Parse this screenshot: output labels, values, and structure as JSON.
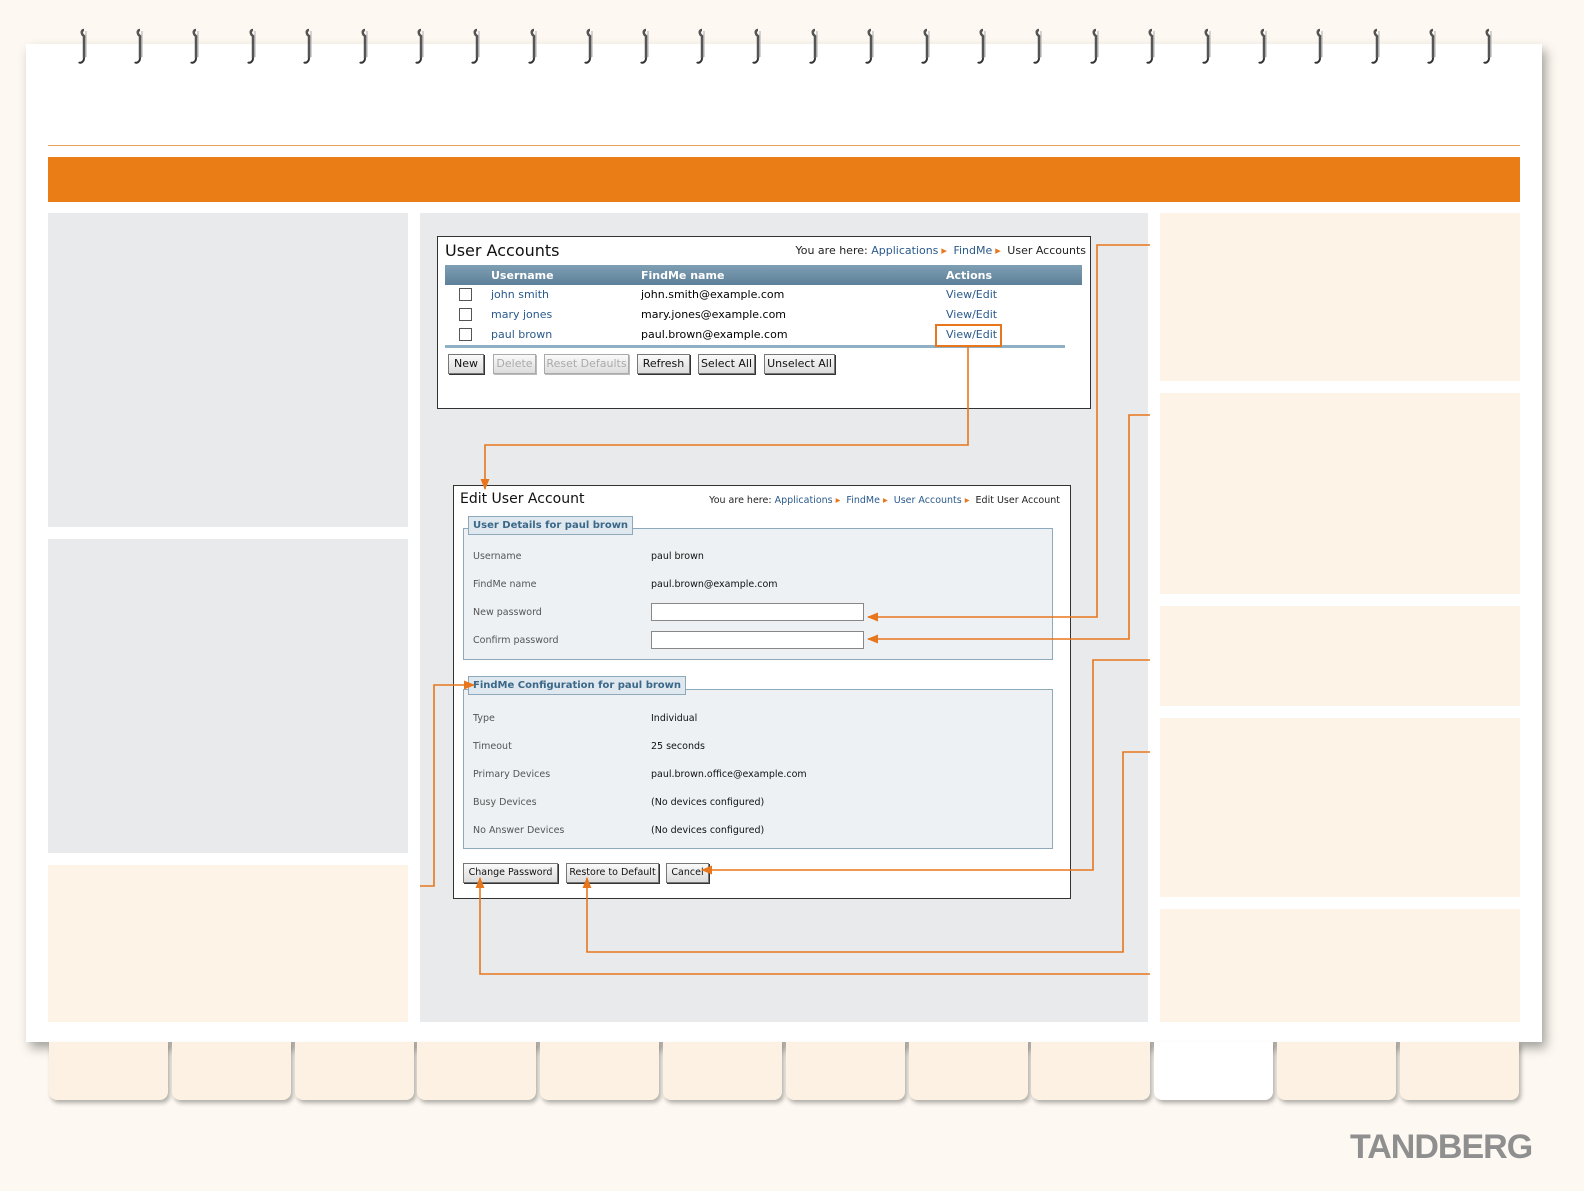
{
  "user_accounts": {
    "title": "User Accounts",
    "breadcrumb": {
      "prefix": "You are here:",
      "items": [
        "Applications",
        "FindMe",
        "User Accounts"
      ]
    },
    "columns": [
      "Username",
      "FindMe name",
      "Actions"
    ],
    "rows": [
      {
        "username": "john smith",
        "findme": "john.smith@example.com",
        "action": "View/Edit"
      },
      {
        "username": "mary jones",
        "findme": "mary.jones@example.com",
        "action": "View/Edit"
      },
      {
        "username": "paul brown",
        "findme": "paul.brown@example.com",
        "action": "View/Edit"
      }
    ],
    "buttons": {
      "new": "New",
      "delete": "Delete",
      "reset_defaults": "Reset Defaults",
      "refresh": "Refresh",
      "select_all": "Select All",
      "unselect_all": "Unselect All"
    }
  },
  "edit_user": {
    "title": "Edit User Account",
    "breadcrumb": {
      "prefix": "You are here:",
      "items": [
        "Applications",
        "FindMe",
        "User Accounts",
        "Edit User Account"
      ]
    },
    "details_legend": "User Details for paul brown",
    "details": {
      "username_label": "Username",
      "username_value": "paul brown",
      "findme_label": "FindMe name",
      "findme_value": "paul.brown@example.com",
      "new_password_label": "New password",
      "new_password_value": "",
      "confirm_password_label": "Confirm password",
      "confirm_password_value": ""
    },
    "config_legend": "FindMe Configuration for paul brown",
    "config": {
      "type_label": "Type",
      "type_value": "Individual",
      "timeout_label": "Timeout",
      "timeout_value": "25 seconds",
      "primary_label": "Primary Devices",
      "primary_value": "paul.brown.office@example.com",
      "busy_label": "Busy Devices",
      "busy_value": "(No devices configured)",
      "noanswer_label": "No Answer Devices",
      "noanswer_value": "(No devices configured)"
    },
    "buttons": {
      "change_password": "Change Password",
      "restore_default": "Restore to Default",
      "cancel": "Cancel"
    }
  },
  "brand": {
    "logo_text": "TANDBERG"
  },
  "colors": {
    "accent": "#ea7d15",
    "grey_panel": "#e9eaeb",
    "cream_panel": "#fdf3e7",
    "link": "#2a5a8c"
  }
}
